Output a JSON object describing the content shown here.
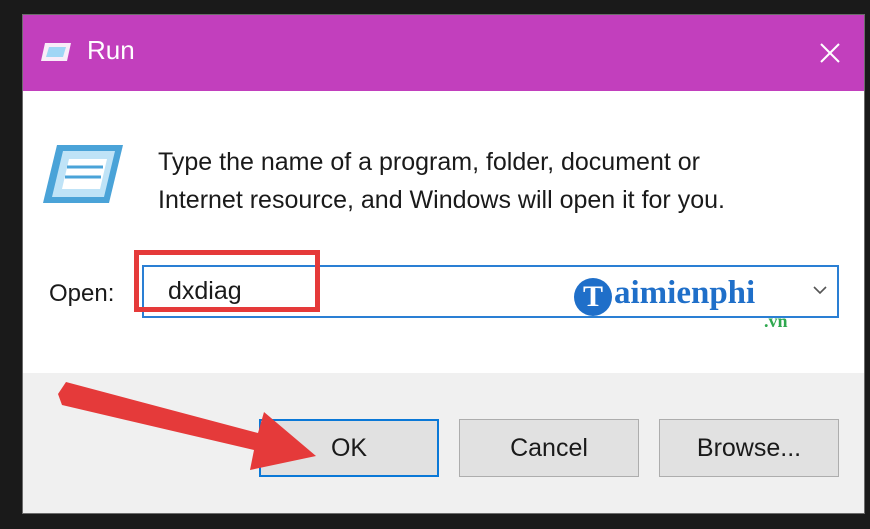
{
  "window": {
    "title": "Run",
    "close_icon": "close-icon"
  },
  "description": {
    "line1": "Type the name of a program, folder, document or",
    "line2": "Internet resource, and Windows will open it for you."
  },
  "open_field": {
    "label": "Open:",
    "value": "dxdiag"
  },
  "watermark": {
    "logo_letter": "T",
    "text": "aimienphi",
    "suffix": ".vn"
  },
  "buttons": {
    "ok": "OK",
    "cancel": "Cancel",
    "browse": "Browse..."
  },
  "colors": {
    "titlebar": "#c23fbd",
    "highlight": "#e53a3a",
    "focus_border": "#0a78d7"
  }
}
